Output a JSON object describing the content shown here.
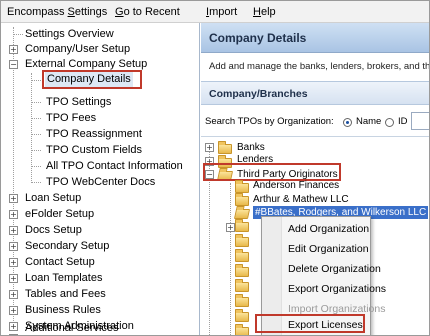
{
  "menubar": {
    "items": [
      {
        "pre": "Encompass ",
        "u": "S",
        "post": "ettings"
      },
      {
        "pre": "",
        "u": "G",
        "post": "o to Recent"
      },
      {
        "pre": "",
        "u": "I",
        "post": "mport"
      },
      {
        "pre": "",
        "u": "H",
        "post": "elp"
      }
    ]
  },
  "tree": {
    "items": [
      {
        "label": "Settings Overview"
      },
      {
        "label": "Company/User Setup",
        "expander": "+"
      },
      {
        "label": "External Company Setup",
        "expander": "−"
      },
      {
        "label": "Company Details",
        "selected": true
      },
      {
        "label": "TPO Settings"
      },
      {
        "label": "TPO Fees"
      },
      {
        "label": "TPO Reassignment"
      },
      {
        "label": "TPO Custom Fields"
      },
      {
        "label": "All TPO Contact Information"
      },
      {
        "label": "TPO WebCenter Docs"
      },
      {
        "label": "Loan Setup",
        "expander": "+"
      },
      {
        "label": "eFolder Setup",
        "expander": "+"
      },
      {
        "label": "Docs Setup",
        "expander": "+"
      },
      {
        "label": "Secondary Setup",
        "expander": "+"
      },
      {
        "label": "Contact Setup",
        "expander": "+"
      },
      {
        "label": "Loan Templates",
        "expander": "+"
      },
      {
        "label": "Tables and Fees",
        "expander": "+"
      },
      {
        "label": "Business Rules",
        "expander": "+"
      },
      {
        "label": "System Administration",
        "expander": "+"
      },
      {
        "label": "Additional Services",
        "expander": "+"
      }
    ]
  },
  "panel": {
    "title": "Company Details",
    "description": "Add and manage the banks, lenders, brokers, and th",
    "subheader": "Company/Branches",
    "search_label": "Search TPOs by Organization:",
    "radio_name": "Name",
    "radio_id": "ID"
  },
  "org_tree": {
    "items": [
      {
        "label": "Banks",
        "expander": "+"
      },
      {
        "label": "Lenders",
        "expander": "+"
      },
      {
        "label": "Third Party Originators",
        "expander": "−"
      },
      {
        "label": "Anderson Finances"
      },
      {
        "label": "Arthur & Mathew LLC"
      },
      {
        "label": "#BBates, Rodgers, and Wilkerson LLC",
        "selected": true
      }
    ]
  },
  "context_menu": {
    "items": [
      {
        "label": "Add Organization",
        "enabled": true
      },
      {
        "label": "Edit Organization",
        "enabled": true
      },
      {
        "label": "Delete Organization",
        "enabled": true
      },
      {
        "label": "Export Organizations",
        "enabled": true
      },
      {
        "label": "Import Organizations",
        "enabled": false
      },
      {
        "label": "Export Licenses",
        "enabled": true
      }
    ]
  },
  "colors": {
    "highlight_border": "#c0392b",
    "selection_blue": "#3a6fc9",
    "header_gradient_top": "#cfe0f3"
  }
}
